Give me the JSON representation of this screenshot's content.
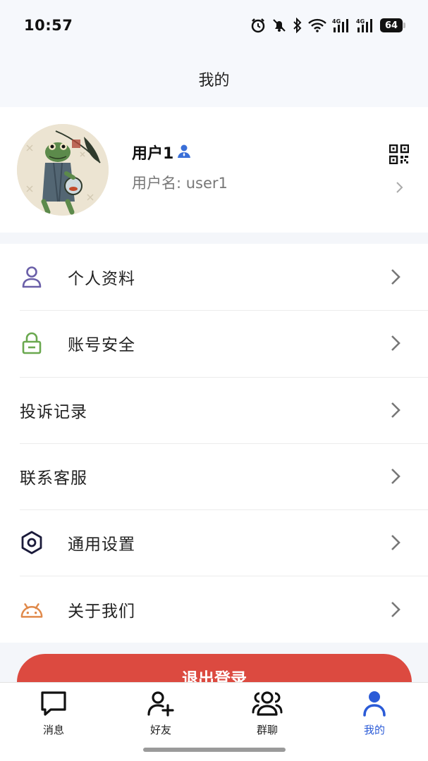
{
  "status_bar": {
    "time": "10:57",
    "battery": "64",
    "icons": [
      "alarm-icon",
      "bell-muted-icon",
      "bluetooth-icon",
      "wifi-icon",
      "signal-4g-icon",
      "signal-4g-icon",
      "battery-icon"
    ]
  },
  "header": {
    "title": "我的"
  },
  "profile": {
    "name": "用户1",
    "username": "用户名: user1",
    "badge_icon": "user-badge-icon",
    "qr_icon": "qr-code-icon"
  },
  "menu": {
    "items": [
      {
        "label": "个人资料",
        "icon": "person-icon",
        "icon_color": "#6a5fa8"
      },
      {
        "label": "账号安全",
        "icon": "lock-icon",
        "icon_color": "#6aa84f"
      },
      {
        "label": "投诉记录",
        "icon": ""
      },
      {
        "label": "联系客服",
        "icon": ""
      },
      {
        "label": "通用设置",
        "icon": "hexagon-settings-icon",
        "icon_color": "#1a1a3a"
      },
      {
        "label": "关于我们",
        "icon": "android-icon",
        "icon_color": "#e0894a"
      }
    ]
  },
  "logout": {
    "label": "退出登录",
    "color": "#dc4a40"
  },
  "tabs": [
    {
      "label": "消息",
      "icon": "chat-icon",
      "active": false
    },
    {
      "label": "好友",
      "icon": "add-friend-icon",
      "active": false
    },
    {
      "label": "群聊",
      "icon": "group-icon",
      "active": false
    },
    {
      "label": "我的",
      "icon": "me-icon",
      "active": true
    }
  ],
  "colors": {
    "accent": "#2b5bd7",
    "background": "#f4f6fa"
  }
}
